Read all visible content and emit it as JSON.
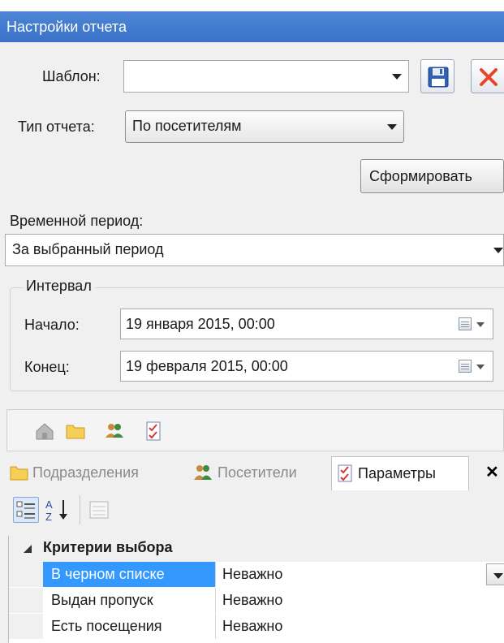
{
  "window": {
    "title": "Настройки отчета"
  },
  "template": {
    "label": "Шаблон:",
    "value": ""
  },
  "report_type": {
    "label": "Тип отчета:",
    "value": "По посетителям"
  },
  "generate_button": "Сформировать",
  "time_period": {
    "label": "Временной период:",
    "value": "За выбранный период"
  },
  "interval": {
    "title": "Интервал",
    "start_label": "Начало:",
    "start_value": "19  января  2015, 00:00",
    "end_label": "Конец:",
    "end_value": "19 февраля  2015, 00:00"
  },
  "tabs": [
    {
      "label": "Подразделения",
      "icon": "folder-icon",
      "active": false
    },
    {
      "label": "Посетители",
      "icon": "visitors-icon",
      "active": false
    },
    {
      "label": "Параметры",
      "icon": "checklist-icon",
      "active": true
    }
  ],
  "tab_close": "✕",
  "property_grid": {
    "category": "Критерии выбора",
    "rows": [
      {
        "name": "В черном списке",
        "value": "Неважно",
        "selected": true
      },
      {
        "name": "Выдан пропуск",
        "value": "Неважно",
        "selected": false
      },
      {
        "name": "Есть посещения",
        "value": "Неважно",
        "selected": false
      }
    ]
  },
  "colors": {
    "title_bar": "#3a72c8",
    "selection": "#3399ff",
    "delete_red": "#e8452a"
  }
}
